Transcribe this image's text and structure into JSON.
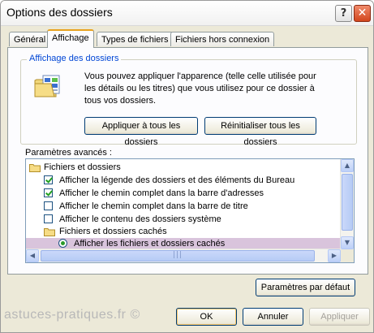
{
  "window": {
    "title": "Options des dossiers"
  },
  "titlebar": {
    "help": "?",
    "close": "✕"
  },
  "tabs": [
    {
      "label": "Général"
    },
    {
      "label": "Affichage"
    },
    {
      "label": "Types de fichiers"
    },
    {
      "label": "Fichiers hors connexion"
    }
  ],
  "folder_view": {
    "title": "Affichage des dossiers",
    "description": "Vous pouvez appliquer l'apparence (telle celle utilisée pour les détails ou les titres) que vous utilisez pour ce dossier à tous vos dossiers.",
    "apply_all": "Appliquer à tous les dossiers",
    "reset_all": "Réinitialiser tous les dossiers"
  },
  "advanced": {
    "label": "Paramètres avancés :",
    "items": [
      {
        "type": "folder",
        "label": "Fichiers et dossiers"
      },
      {
        "type": "checkbox",
        "checked": true,
        "label": "Afficher la légende des dossiers et des éléments du Bureau"
      },
      {
        "type": "checkbox",
        "checked": true,
        "label": "Afficher le chemin complet dans la barre d'adresses"
      },
      {
        "type": "checkbox",
        "checked": false,
        "label": "Afficher le chemin complet dans la barre de titre"
      },
      {
        "type": "checkbox",
        "checked": false,
        "label": "Afficher le contenu des dossiers système"
      },
      {
        "type": "folder",
        "label": "Fichiers et dossiers cachés"
      },
      {
        "type": "radio",
        "checked": true,
        "label": "Afficher les fichiers et dossiers cachés"
      }
    ],
    "defaults": "Paramètres par défaut"
  },
  "footer": {
    "ok": "OK",
    "cancel": "Annuler",
    "apply": "Appliquer"
  },
  "watermark": "astuces-pratiques.fr ©",
  "colors": {
    "selected_row": "#d9c4dc",
    "group_title": "#0046d5",
    "dialog_bg": "#ece9d8"
  }
}
